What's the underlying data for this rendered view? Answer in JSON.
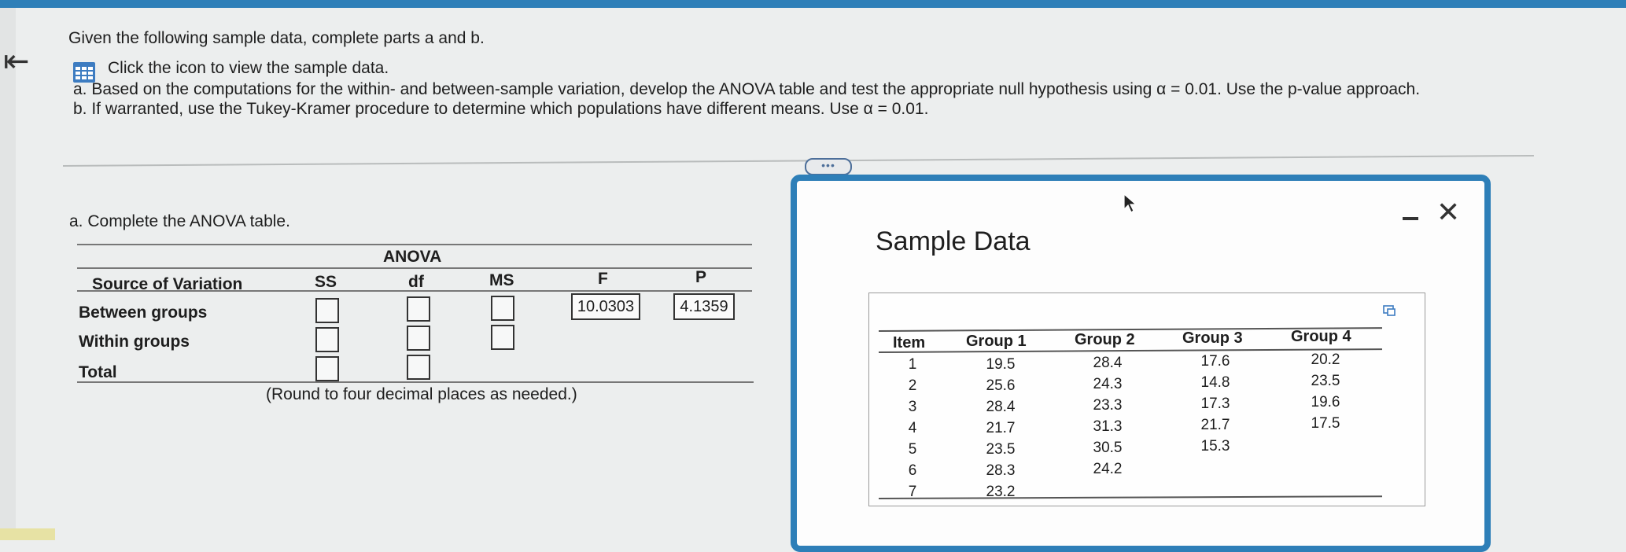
{
  "question": {
    "intro": "Given the following sample data, complete parts a and b.",
    "icon_link": "Click the icon to view the sample data.",
    "part_a": "a. Based on the computations for the within- and between-sample variation, develop the ANOVA table and test the appropriate null hypothesis using α = 0.01. Use the p-value approach.",
    "part_b": "b. If warranted, use the Tukey-Kramer procedure to determine which populations have different means. Use α = 0.01."
  },
  "more_button": "•••",
  "anova": {
    "prompt": "a. Complete the ANOVA table.",
    "title": "ANOVA",
    "headers": {
      "source": "Source of Variation",
      "ss": "SS",
      "df": "df",
      "ms": "MS",
      "f": "F",
      "p": "P"
    },
    "rows": {
      "between": "Between groups",
      "within": "Within groups",
      "total": "Total"
    },
    "f_value": "10.0303",
    "p_value": "4.1359",
    "note": "(Round to four decimal places as needed.)"
  },
  "popup": {
    "title": "Sample Data",
    "headers": [
      "Item",
      "Group 1",
      "Group 2",
      "Group 3",
      "Group 4"
    ],
    "items": [
      "1",
      "2",
      "3",
      "4",
      "5",
      "6",
      "7"
    ],
    "group1": [
      "19.5",
      "25.6",
      "28.4",
      "21.7",
      "23.5",
      "28.3",
      "23.2"
    ],
    "group2": [
      "28.4",
      "24.3",
      "23.3",
      "31.3",
      "30.5",
      "24.2"
    ],
    "group3": [
      "17.6",
      "14.8",
      "17.3",
      "21.7",
      "15.3"
    ],
    "group4": [
      "20.2",
      "23.5",
      "19.6",
      "17.5"
    ]
  },
  "colors": {
    "accent": "#2e7fb8",
    "background": "#eceeee"
  }
}
